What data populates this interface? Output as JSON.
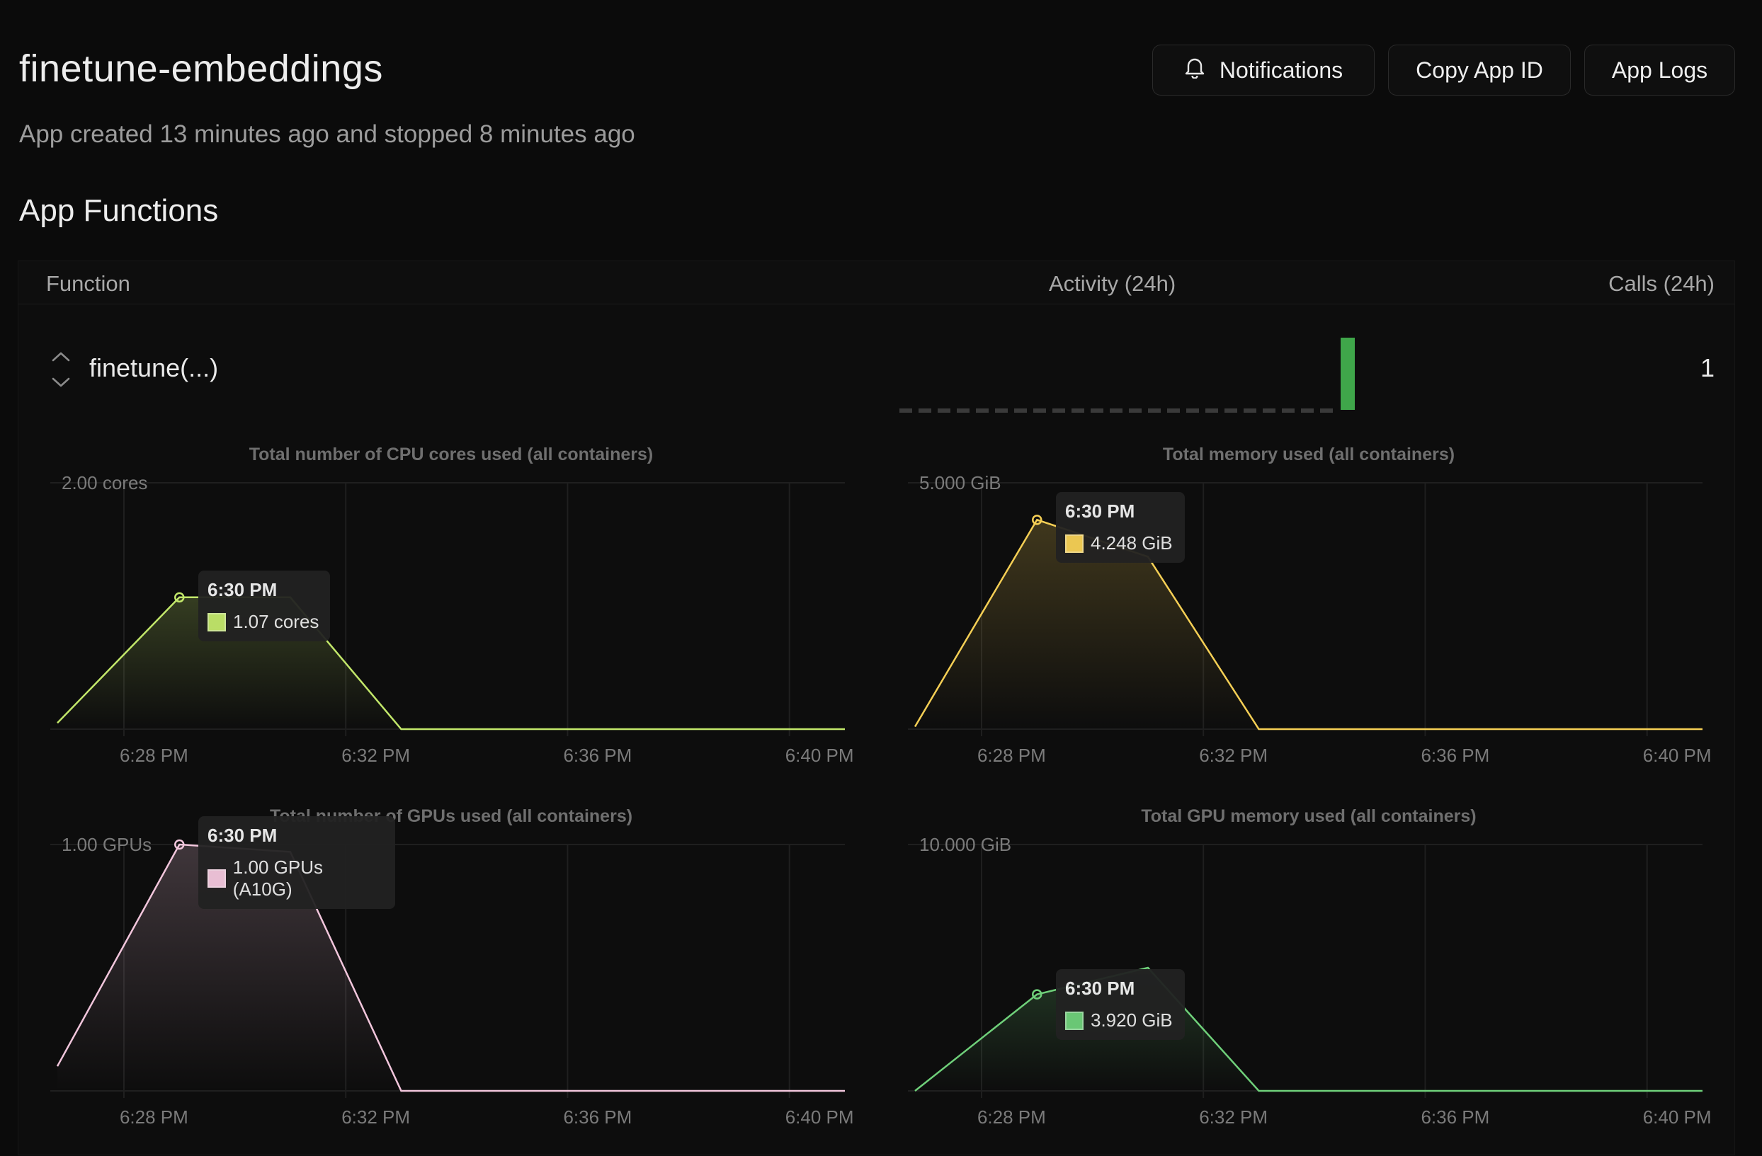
{
  "app": {
    "title": "finetune-embeddings",
    "subtitle": "App created 13 minutes ago and stopped 8 minutes ago"
  },
  "header_buttons": {
    "notifications": "Notifications",
    "copy_app_id": "Copy App ID",
    "app_logs": "App Logs"
  },
  "icons": {
    "notifications": "bell-icon",
    "expand": "chevron-up-down-icon"
  },
  "section_title": "App Functions",
  "table": {
    "columns": [
      "Function",
      "Activity (24h)",
      "Calls (24h)"
    ],
    "rows": [
      {
        "function": "finetune(...)",
        "calls": "1",
        "activity_bars": 24,
        "activity_active_index": 23
      }
    ]
  },
  "colors": {
    "cpu": "#c2e76a",
    "memory": "#f5cf55",
    "gpu": "#f2c6dc",
    "gpu_memory": "#6fd07a",
    "activity": "#3fa64a"
  },
  "chart_data": [
    {
      "type": "area",
      "title": "Total number of CPU cores used (all containers)",
      "x": [
        "6:27",
        "6:29",
        "6:31",
        "6:33",
        "6:41"
      ],
      "series": [
        {
          "values": [
            0.05,
            1.07,
            1.07,
            0.0,
            0.0
          ]
        }
      ],
      "ylim": [
        0,
        2.0
      ],
      "ytick_label": "2.00 cores",
      "xticks": [
        "6:28 PM",
        "6:32 PM",
        "6:36 PM",
        "6:40 PM"
      ],
      "grid": true,
      "tooltip": {
        "time": "6:30 PM",
        "value": "1.07 cores"
      }
    },
    {
      "type": "area",
      "title": "Total memory used (all containers)",
      "x": [
        "6:27",
        "6:29",
        "6:31",
        "6:33",
        "6:41"
      ],
      "series": [
        {
          "values": [
            0.05,
            4.248,
            3.5,
            0.0,
            0.0
          ]
        }
      ],
      "ylim": [
        0,
        5.0
      ],
      "ytick_label": "5.000 GiB",
      "xticks": [
        "6:28 PM",
        "6:32 PM",
        "6:36 PM",
        "6:40 PM"
      ],
      "grid": true,
      "tooltip": {
        "time": "6:30 PM",
        "value": "4.248 GiB"
      }
    },
    {
      "type": "area",
      "title": "Total number of GPUs used (all containers)",
      "x": [
        "6:27",
        "6:29",
        "6:31",
        "6:33",
        "6:41"
      ],
      "series": [
        {
          "values": [
            0.1,
            1.0,
            0.97,
            0.0,
            0.0
          ]
        }
      ],
      "ylim": [
        0,
        1.0
      ],
      "ytick_label": "1.00 GPUs",
      "xticks": [
        "6:28 PM",
        "6:32 PM",
        "6:36 PM",
        "6:40 PM"
      ],
      "grid": true,
      "tooltip": {
        "time": "6:30 PM",
        "value": "1.00 GPUs (A10G)"
      }
    },
    {
      "type": "area",
      "title": "Total GPU memory used (all containers)",
      "x": [
        "6:27",
        "6:29",
        "6:31",
        "6:33",
        "6:41"
      ],
      "series": [
        {
          "values": [
            0.0,
            3.92,
            5.0,
            0.0,
            0.0
          ]
        }
      ],
      "ylim": [
        0,
        10.0
      ],
      "ytick_label": "10.000 GiB",
      "xticks": [
        "6:28 PM",
        "6:32 PM",
        "6:36 PM",
        "6:40 PM"
      ],
      "grid": true,
      "tooltip": {
        "time": "6:30 PM",
        "value": "3.920 GiB"
      }
    }
  ]
}
